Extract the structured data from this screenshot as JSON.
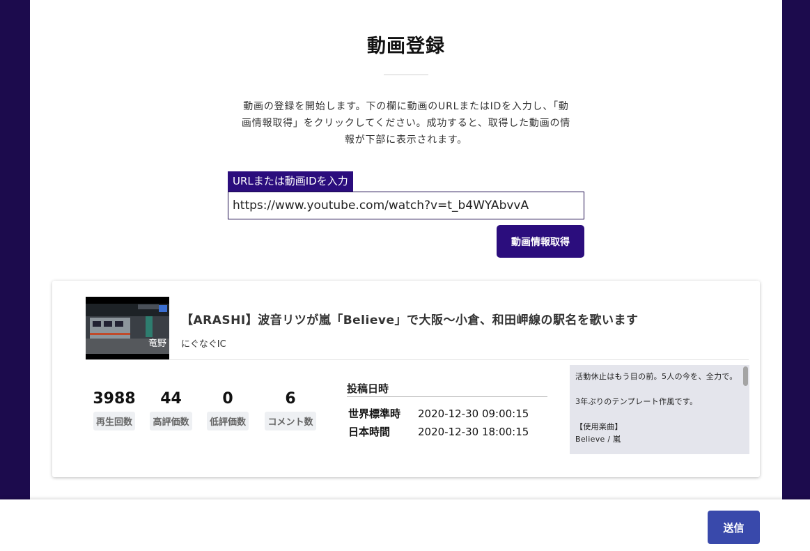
{
  "page": {
    "title": "動画登録",
    "description": "動画の登録を開始します。下の欄に動画のURLまたはIDを入力し、「動画情報取得」をクリックしてください。成功すると、取得した動画の情報が下部に表示されます。"
  },
  "form": {
    "url_label": "URLまたは動画IDを入力",
    "url_value": "https://www.youtube.com/watch?v=t_b4WYAbvvA",
    "fetch_button": "動画情報取得"
  },
  "video": {
    "thumbnail_station": "竜野",
    "title": "【ARASHI】波音リツが嵐「Believe」で大阪〜小倉、和田岬線の駅名を歌います",
    "channel": "にぐなぐIC",
    "stats": [
      {
        "value": "3988",
        "label": "再生回数"
      },
      {
        "value": "44",
        "label": "高評価数"
      },
      {
        "value": "0",
        "label": "低評価数"
      },
      {
        "value": "6",
        "label": "コメント数"
      }
    ],
    "posted": {
      "heading": "投稿日時",
      "utc_label": "世界標準時",
      "utc_value": "2020-12-30 09:00:15",
      "jst_label": "日本時間",
      "jst_value": "2020-12-30 18:00:15"
    },
    "description_lines": [
      "活動休止はもう目の前。5人の今を、全力で。",
      "",
      "3年ぶりのテンプレート作風です。",
      "",
      "【使用楽曲】",
      "Believe / 嵐"
    ]
  },
  "footer": {
    "send_button": "送信"
  },
  "colors": {
    "background": "#1c0b4d",
    "accent": "#2b0d7d",
    "send_button": "#3949ab"
  }
}
